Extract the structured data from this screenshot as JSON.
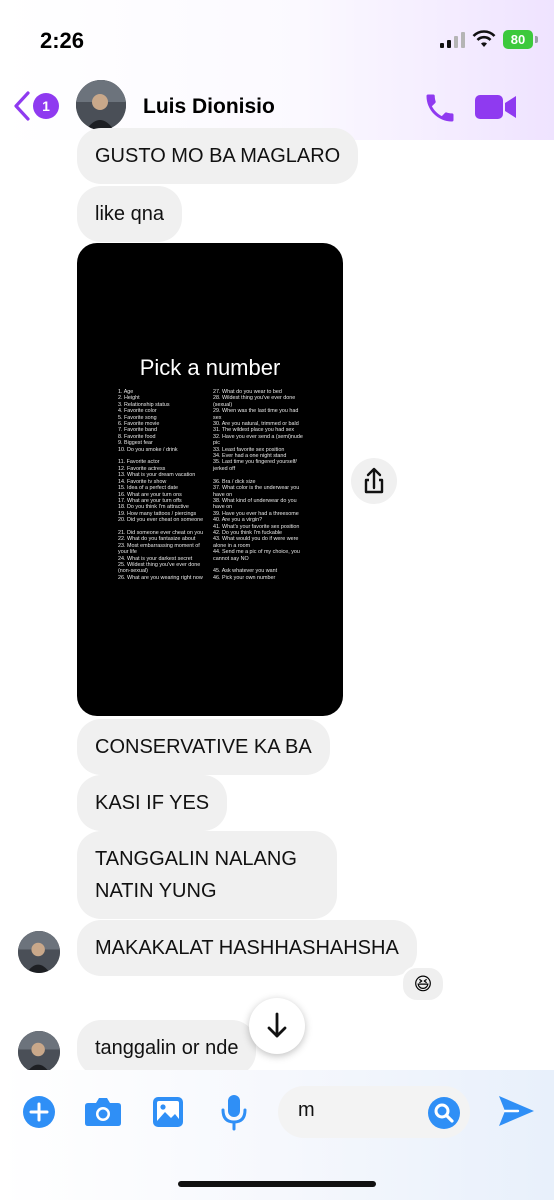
{
  "status_bar": {
    "time": "2:26",
    "battery": "80"
  },
  "header": {
    "unread_count": "1",
    "contact_name": "Luis Dionisio"
  },
  "messages": [
    {
      "text": "GUSTO MO BA MAGLARO"
    },
    {
      "text": "like qna"
    },
    {
      "text": "CONSERVATIVE KA BA"
    },
    {
      "text": "KASI IF YES"
    },
    {
      "lines": [
        "TANGGALIN NALANG",
        "NATIN YUNG"
      ]
    },
    {
      "text": "MAKAKALAT HASHHASHAHSHA",
      "reaction": "😆"
    },
    {
      "text": "tanggalin or nde"
    }
  ],
  "photo": {
    "title": "Pick a number",
    "left_column": [
      "1. Age",
      "2. Height",
      "3. Relationship status",
      "4. Favorite color",
      "5. Favorite song",
      "6. Favorite movie",
      "7. Favorite band",
      "8. Favorite food",
      "9. Biggest fear",
      "10. Do you smoke / drink",
      "",
      "11. Favorite actor",
      "12. Favorite actress",
      "13. What is your dream vacation",
      "14. Favorite tv show",
      "15. Idea of a perfect date",
      "16. What are your turn ons",
      "17. What are your turn offs",
      "18. Do you think I'm attractive",
      "19. How many tattoos / piercings",
      "20. Did you ever cheat on someone",
      "",
      "21. Did someone ever cheat on you",
      "22. What do you fantasize about",
      "23. Most embarrassing moment of",
      "your life",
      "24. What is your darkest secret",
      "25. Wildest thing you've ever done",
      "(non-sexual)",
      "26. What are you wearing right now"
    ],
    "right_column": [
      "27. What do you wear to bed",
      "28. Wildest thing you've ever done",
      "(sexual)",
      "29. When was the last time you had",
      "sex",
      "30. Are you natural, trimmed or bald",
      "31. The wildest place you had sex",
      "32. Have you ever send a (semi)nude",
      "pic",
      "33. Least favorite sex position",
      "34. Ever had a one night stand",
      "35. Last time you fingered yourself/",
      "jerked off",
      "",
      "36. Bra / dick size",
      "37. What color is the underwear you",
      "have on",
      "38. What kind of underwear do you",
      "have on",
      "39. Have you ever had a threesome",
      "40. Are you a virgin?",
      "41. What's your favorite sex position",
      "42. Do you think I'm fuckable",
      "43. What would you do if were were",
      "alone in a room",
      "44. Send me a pic of my choice, you",
      "cannot say NO",
      "",
      "45. Ask whatever you want",
      "46. Pick your own number"
    ]
  },
  "composer": {
    "input_value": "m"
  },
  "colors": {
    "accent": "#8f3af0",
    "send_blue": "#2f8ff6",
    "bubble_gray": "#f0f0f0"
  }
}
